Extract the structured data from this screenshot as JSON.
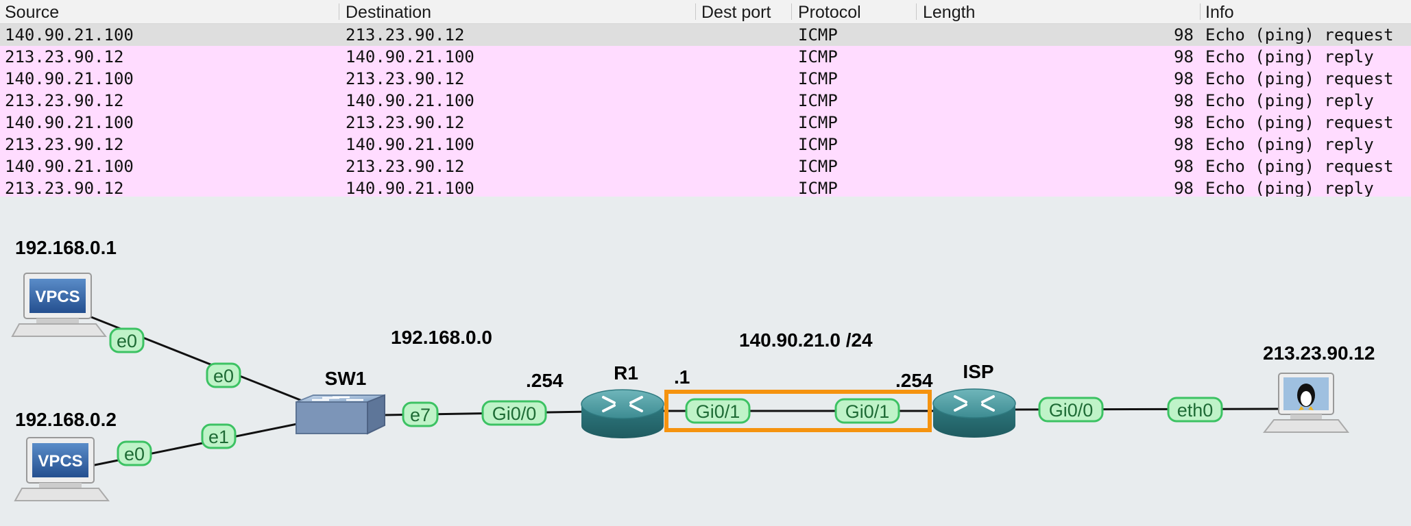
{
  "packet_table": {
    "columns": {
      "source": "Source",
      "destination": "Destination",
      "dest_port": "Dest port",
      "protocol": "Protocol",
      "length": "Length",
      "info": "Info"
    },
    "rows": [
      {
        "source": "140.90.21.100",
        "destination": "213.23.90.12",
        "dest_port": "",
        "protocol": "ICMP",
        "length": "98",
        "info": "Echo (ping) request",
        "selected": true
      },
      {
        "source": "213.23.90.12",
        "destination": "140.90.21.100",
        "dest_port": "",
        "protocol": "ICMP",
        "length": "98",
        "info": "Echo (ping) reply"
      },
      {
        "source": "140.90.21.100",
        "destination": "213.23.90.12",
        "dest_port": "",
        "protocol": "ICMP",
        "length": "98",
        "info": "Echo (ping) request"
      },
      {
        "source": "213.23.90.12",
        "destination": "140.90.21.100",
        "dest_port": "",
        "protocol": "ICMP",
        "length": "98",
        "info": "Echo (ping) reply"
      },
      {
        "source": "140.90.21.100",
        "destination": "213.23.90.12",
        "dest_port": "",
        "protocol": "ICMP",
        "length": "98",
        "info": "Echo (ping) request"
      },
      {
        "source": "213.23.90.12",
        "destination": "140.90.21.100",
        "dest_port": "",
        "protocol": "ICMP",
        "length": "98",
        "info": "Echo (ping) reply"
      },
      {
        "source": "140.90.21.100",
        "destination": "213.23.90.12",
        "dest_port": "",
        "protocol": "ICMP",
        "length": "98",
        "info": "Echo (ping) request"
      },
      {
        "source": "213.23.90.12",
        "destination": "140.90.21.100",
        "dest_port": "",
        "protocol": "ICMP",
        "length": "98",
        "info": "Echo (ping) reply"
      }
    ],
    "colors": {
      "row_highlight": "#ffdcff",
      "row_selected": "#dedede",
      "header_bg": "#f2f2f2"
    }
  },
  "topology": {
    "labels": {
      "pc1_ip": "192.168.0.1",
      "pc2_ip": "192.168.0.2",
      "lan_subnet": "192.168.0.0",
      "r1_lan_host": ".254",
      "r1_wan_host": ".1",
      "wan_subnet": "140.90.21.0 /24",
      "isp_host": ".254",
      "server_ip": "213.23.90.12"
    },
    "devices": {
      "pc1": {
        "name": "VPCS",
        "icon": "computer-icon"
      },
      "pc2": {
        "name": "VPCS",
        "icon": "computer-icon"
      },
      "switch": {
        "name": "SW1",
        "icon": "switch-icon"
      },
      "router1": {
        "name": "R1",
        "icon": "router-icon"
      },
      "isp": {
        "name": "ISP",
        "icon": "router-icon"
      },
      "server": {
        "name": "",
        "icon": "linux-host-icon"
      }
    },
    "interfaces": {
      "pc1_e0": "e0",
      "sw1_e0": "e0",
      "pc2_e0": "e0",
      "sw1_e1": "e1",
      "sw1_e7": "e7",
      "r1_gi00": "Gi0/0",
      "r1_gi01": "Gi0/1",
      "isp_gi01": "Gi0/1",
      "isp_gi00": "Gi0/0",
      "server_eth0": "eth0"
    },
    "colors": {
      "interface_fill": "#bff3c8",
      "interface_stroke": "#3cc263",
      "highlight_box": "#f5930f",
      "router": "#3b8a8f"
    }
  }
}
